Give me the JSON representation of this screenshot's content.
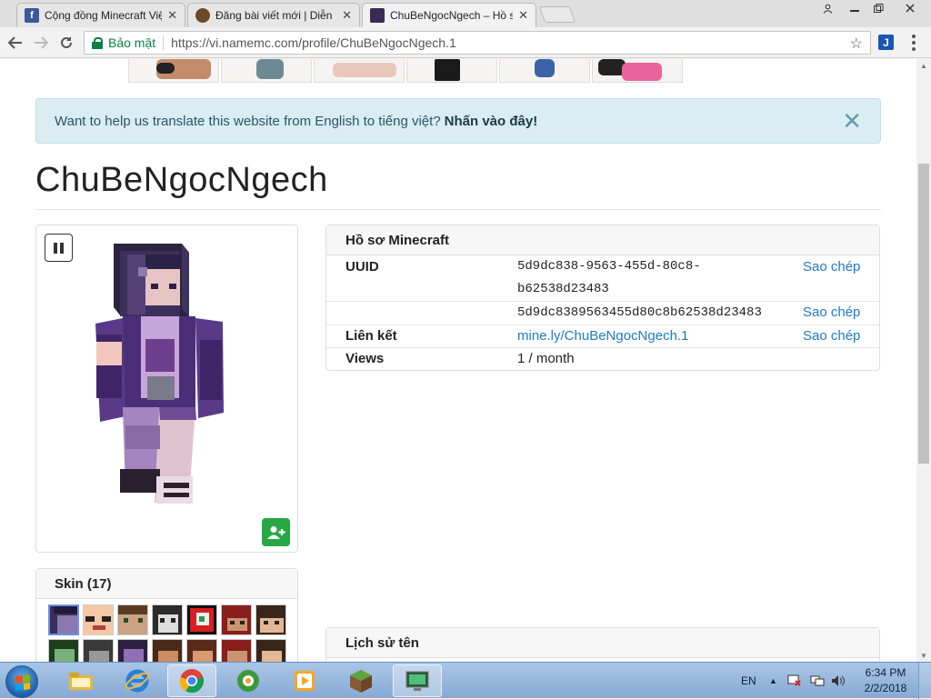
{
  "browser": {
    "tabs": [
      {
        "title": "Cộng đồng Minecraft Việ",
        "close": "✕",
        "favicon": "facebook-icon"
      },
      {
        "title": "Đăng bài viết mới | Diễn",
        "close": "✕",
        "favicon": "minecraft-forum-icon"
      },
      {
        "title": "ChuBeNgocNgech – Hồ s",
        "close": "✕",
        "favicon": "skin-head-icon",
        "active": true
      }
    ],
    "secure_label": "Bảo mật",
    "url": "https://vi.namemc.com/profile/ChuBeNgocNgech.1",
    "extension_label": "J"
  },
  "banner": {
    "text": "Want to help us translate this website from English to tiếng việt?",
    "link": "Nhấn vào đây!"
  },
  "profile_name": "ChuBeNgocNgech",
  "minecraft_profile": {
    "heading": "Hồ sơ Minecraft",
    "uuid_label": "UUID",
    "uuid_line1": "5d9dc838-9563-455d-80c8-",
    "uuid_line2": "b62538d23483",
    "uuid_plain": "5d9dc8389563455d80c8b62538d23483",
    "link_label": "Liên kết",
    "link_value": "mine.ly/ChuBeNgocNgech.1",
    "views_label": "Views",
    "views_value": "1 / month",
    "copy": "Sao chép"
  },
  "skins": {
    "heading": "Skin (17)"
  },
  "name_history": {
    "heading": "Lịch sử tên"
  },
  "taskbar": {
    "language": "EN",
    "time": "6:34 PM",
    "date": "2/2/2018"
  },
  "colors": {
    "alert_bg": "#d9edf3",
    "link": "#1f7ac4",
    "follow_button": "#28a745",
    "secure": "#0b8043"
  }
}
